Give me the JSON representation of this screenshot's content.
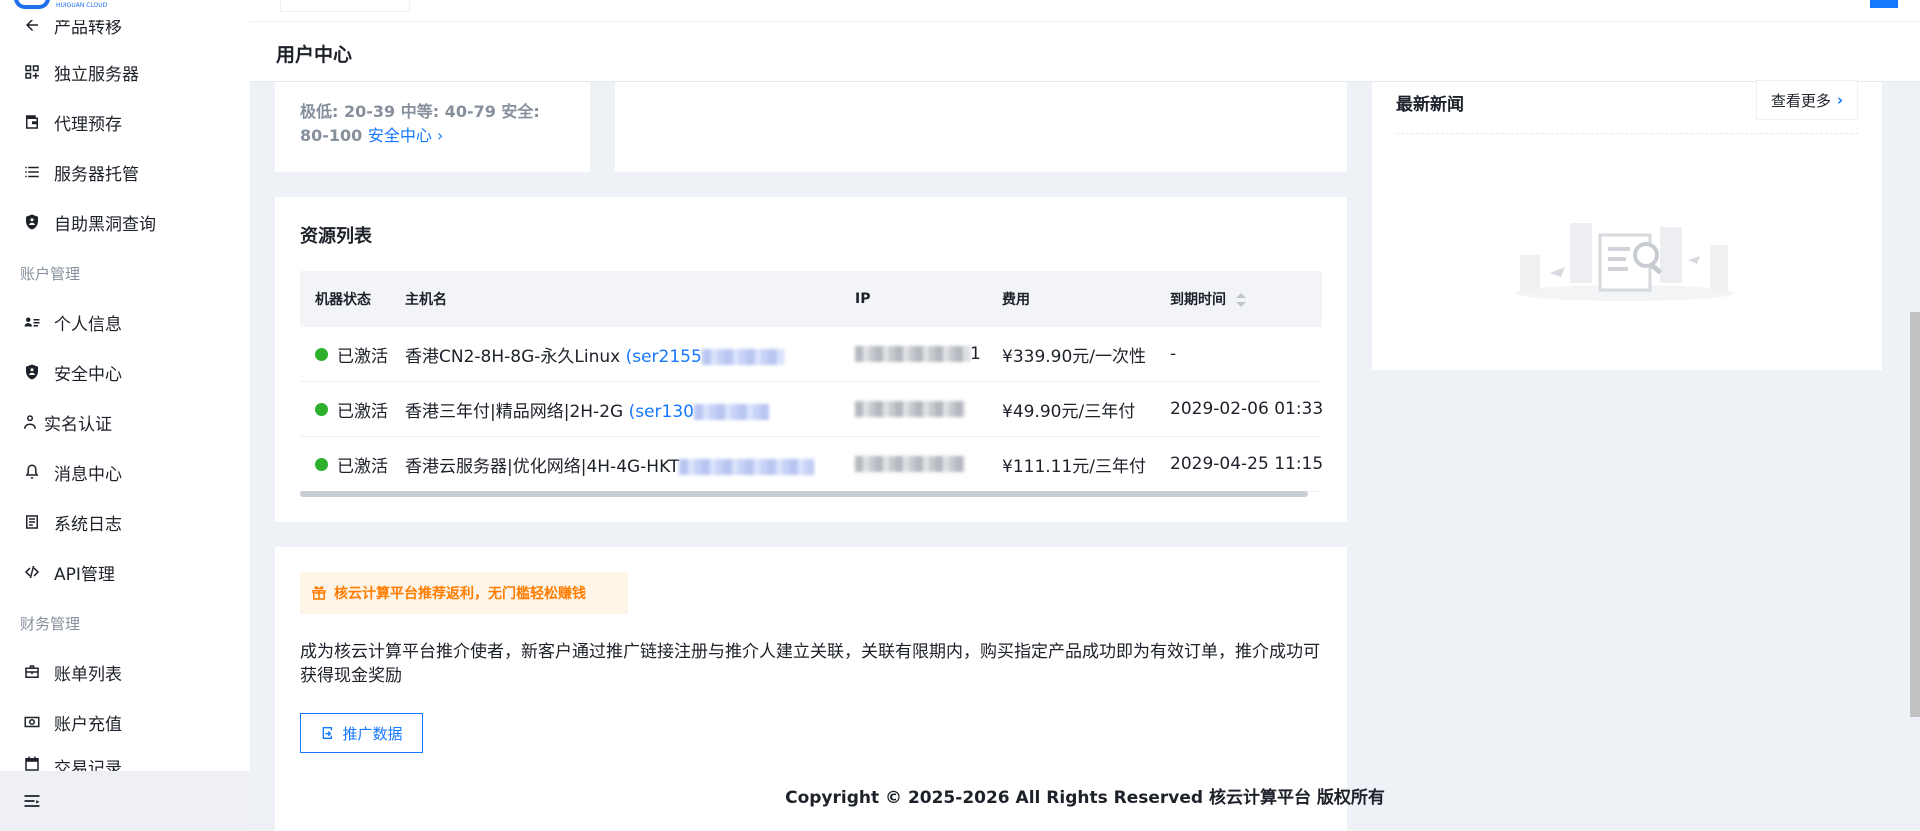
{
  "sidebar": {
    "partial_top_label": "产品转移",
    "items": [
      {
        "label": "独立服务器",
        "icon": "grid-icon"
      },
      {
        "label": "代理预存",
        "icon": "wallet-icon"
      },
      {
        "label": "服务器托管",
        "icon": "list-icon"
      },
      {
        "label": "自助黑洞查询",
        "icon": "shield-icon"
      },
      {
        "label": "个人信息",
        "icon": "user-card-icon"
      },
      {
        "label": "安全中心",
        "icon": "shield-icon"
      },
      {
        "label": "实名认证",
        "icon": "person-icon"
      },
      {
        "label": "消息中心",
        "icon": "bell-icon"
      },
      {
        "label": "系统日志",
        "icon": "log-icon"
      },
      {
        "label": "API管理",
        "icon": "code-icon"
      },
      {
        "label": "账单列表",
        "icon": "briefcase-icon"
      },
      {
        "label": "账户充值",
        "icon": "recharge-icon"
      },
      {
        "label": "交易记录",
        "icon": "calendar-icon"
      }
    ],
    "groups": {
      "account": "账户管理",
      "finance": "财务管理"
    },
    "logo_subtext": "HUIGUAN CLOUD"
  },
  "header": {
    "page_title": "用户中心"
  },
  "security": {
    "legend": "极低: 20-39 中等: 40-79 安全: 80-100",
    "link": "安全中心"
  },
  "resources": {
    "title": "资源列表",
    "columns": [
      "机器状态",
      "主机名",
      "IP",
      "费用",
      "到期时间"
    ],
    "rows": [
      {
        "status": "已激活",
        "host": "香港CN2-8H-8G-永久Linux",
        "host_link": "(ser2155",
        "ip_tail": "1",
        "fee": "¥339.90元/一次性",
        "expire": "-"
      },
      {
        "status": "已激活",
        "host": "香港三年付|精品网络|2H-2G",
        "host_link": "(ser130",
        "ip_tail": "",
        "fee": "¥49.90元/三年付",
        "expire": "2029-02-06 01:33"
      },
      {
        "status": "已激活",
        "host": "香港云服务器|优化网络|4H-4G-HKT",
        "host_link": "",
        "ip_tail": "",
        "fee": "¥111.11元/三年付",
        "expire": "2029-04-25 11:15"
      }
    ]
  },
  "referral": {
    "badge": "核云计算平台推荐返利，无门槛轻松赚钱",
    "description": "成为核云计算平台推介使者，新客户通过推广链接注册与推介人建立关联，关联有限期内，购买指定产品成功即为有效订单，推介成功可获得现金奖励",
    "button": "推广数据"
  },
  "news": {
    "title": "最新新闻",
    "more": "查看更多"
  },
  "footer": {
    "copyright": "Copyright © 2025-2026 All Rights Reserved 核云计算平台 版权所有"
  },
  "colors": {
    "accent": "#1677ff",
    "active": "#2db12d",
    "warning": "#ff7d00"
  }
}
